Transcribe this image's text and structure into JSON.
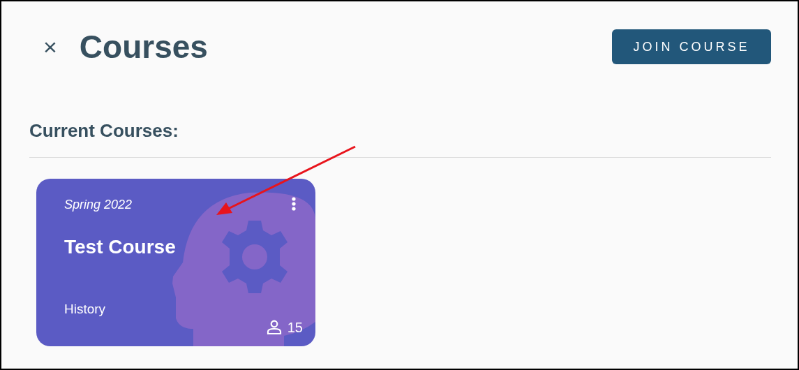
{
  "header": {
    "close": "×",
    "title": "Courses",
    "join_button": "JOIN COURSE"
  },
  "section_title": "Current Courses:",
  "courses": [
    {
      "term": "Spring 2022",
      "name": "Test Course",
      "subject": "History",
      "students": "15",
      "color": "#5b5bc4"
    }
  ]
}
